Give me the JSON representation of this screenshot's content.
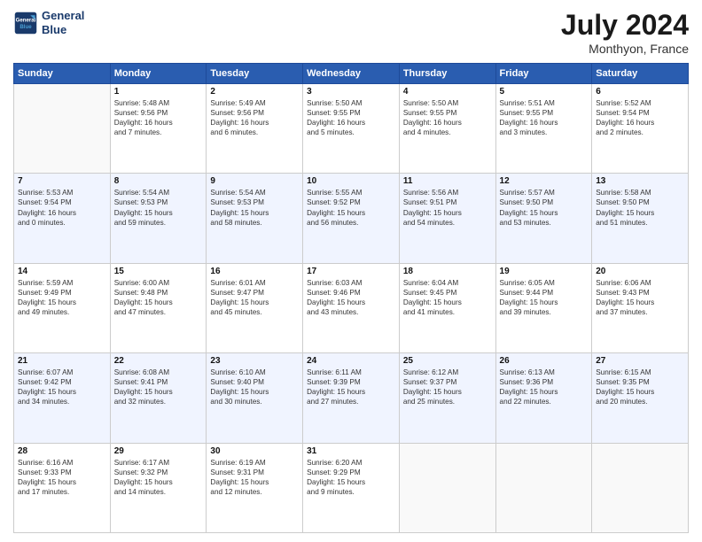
{
  "logo": {
    "line1": "General",
    "line2": "Blue"
  },
  "title": "July 2024",
  "location": "Monthyon, France",
  "days_header": [
    "Sunday",
    "Monday",
    "Tuesday",
    "Wednesday",
    "Thursday",
    "Friday",
    "Saturday"
  ],
  "weeks": [
    {
      "alt": false,
      "cells": [
        {
          "day": "",
          "info": ""
        },
        {
          "day": "1",
          "info": "Sunrise: 5:48 AM\nSunset: 9:56 PM\nDaylight: 16 hours\nand 7 minutes."
        },
        {
          "day": "2",
          "info": "Sunrise: 5:49 AM\nSunset: 9:56 PM\nDaylight: 16 hours\nand 6 minutes."
        },
        {
          "day": "3",
          "info": "Sunrise: 5:50 AM\nSunset: 9:55 PM\nDaylight: 16 hours\nand 5 minutes."
        },
        {
          "day": "4",
          "info": "Sunrise: 5:50 AM\nSunset: 9:55 PM\nDaylight: 16 hours\nand 4 minutes."
        },
        {
          "day": "5",
          "info": "Sunrise: 5:51 AM\nSunset: 9:55 PM\nDaylight: 16 hours\nand 3 minutes."
        },
        {
          "day": "6",
          "info": "Sunrise: 5:52 AM\nSunset: 9:54 PM\nDaylight: 16 hours\nand 2 minutes."
        }
      ]
    },
    {
      "alt": true,
      "cells": [
        {
          "day": "7",
          "info": "Sunrise: 5:53 AM\nSunset: 9:54 PM\nDaylight: 16 hours\nand 0 minutes."
        },
        {
          "day": "8",
          "info": "Sunrise: 5:54 AM\nSunset: 9:53 PM\nDaylight: 15 hours\nand 59 minutes."
        },
        {
          "day": "9",
          "info": "Sunrise: 5:54 AM\nSunset: 9:53 PM\nDaylight: 15 hours\nand 58 minutes."
        },
        {
          "day": "10",
          "info": "Sunrise: 5:55 AM\nSunset: 9:52 PM\nDaylight: 15 hours\nand 56 minutes."
        },
        {
          "day": "11",
          "info": "Sunrise: 5:56 AM\nSunset: 9:51 PM\nDaylight: 15 hours\nand 54 minutes."
        },
        {
          "day": "12",
          "info": "Sunrise: 5:57 AM\nSunset: 9:50 PM\nDaylight: 15 hours\nand 53 minutes."
        },
        {
          "day": "13",
          "info": "Sunrise: 5:58 AM\nSunset: 9:50 PM\nDaylight: 15 hours\nand 51 minutes."
        }
      ]
    },
    {
      "alt": false,
      "cells": [
        {
          "day": "14",
          "info": "Sunrise: 5:59 AM\nSunset: 9:49 PM\nDaylight: 15 hours\nand 49 minutes."
        },
        {
          "day": "15",
          "info": "Sunrise: 6:00 AM\nSunset: 9:48 PM\nDaylight: 15 hours\nand 47 minutes."
        },
        {
          "day": "16",
          "info": "Sunrise: 6:01 AM\nSunset: 9:47 PM\nDaylight: 15 hours\nand 45 minutes."
        },
        {
          "day": "17",
          "info": "Sunrise: 6:03 AM\nSunset: 9:46 PM\nDaylight: 15 hours\nand 43 minutes."
        },
        {
          "day": "18",
          "info": "Sunrise: 6:04 AM\nSunset: 9:45 PM\nDaylight: 15 hours\nand 41 minutes."
        },
        {
          "day": "19",
          "info": "Sunrise: 6:05 AM\nSunset: 9:44 PM\nDaylight: 15 hours\nand 39 minutes."
        },
        {
          "day": "20",
          "info": "Sunrise: 6:06 AM\nSunset: 9:43 PM\nDaylight: 15 hours\nand 37 minutes."
        }
      ]
    },
    {
      "alt": true,
      "cells": [
        {
          "day": "21",
          "info": "Sunrise: 6:07 AM\nSunset: 9:42 PM\nDaylight: 15 hours\nand 34 minutes."
        },
        {
          "day": "22",
          "info": "Sunrise: 6:08 AM\nSunset: 9:41 PM\nDaylight: 15 hours\nand 32 minutes."
        },
        {
          "day": "23",
          "info": "Sunrise: 6:10 AM\nSunset: 9:40 PM\nDaylight: 15 hours\nand 30 minutes."
        },
        {
          "day": "24",
          "info": "Sunrise: 6:11 AM\nSunset: 9:39 PM\nDaylight: 15 hours\nand 27 minutes."
        },
        {
          "day": "25",
          "info": "Sunrise: 6:12 AM\nSunset: 9:37 PM\nDaylight: 15 hours\nand 25 minutes."
        },
        {
          "day": "26",
          "info": "Sunrise: 6:13 AM\nSunset: 9:36 PM\nDaylight: 15 hours\nand 22 minutes."
        },
        {
          "day": "27",
          "info": "Sunrise: 6:15 AM\nSunset: 9:35 PM\nDaylight: 15 hours\nand 20 minutes."
        }
      ]
    },
    {
      "alt": false,
      "cells": [
        {
          "day": "28",
          "info": "Sunrise: 6:16 AM\nSunset: 9:33 PM\nDaylight: 15 hours\nand 17 minutes."
        },
        {
          "day": "29",
          "info": "Sunrise: 6:17 AM\nSunset: 9:32 PM\nDaylight: 15 hours\nand 14 minutes."
        },
        {
          "day": "30",
          "info": "Sunrise: 6:19 AM\nSunset: 9:31 PM\nDaylight: 15 hours\nand 12 minutes."
        },
        {
          "day": "31",
          "info": "Sunrise: 6:20 AM\nSunset: 9:29 PM\nDaylight: 15 hours\nand 9 minutes."
        },
        {
          "day": "",
          "info": ""
        },
        {
          "day": "",
          "info": ""
        },
        {
          "day": "",
          "info": ""
        }
      ]
    }
  ]
}
